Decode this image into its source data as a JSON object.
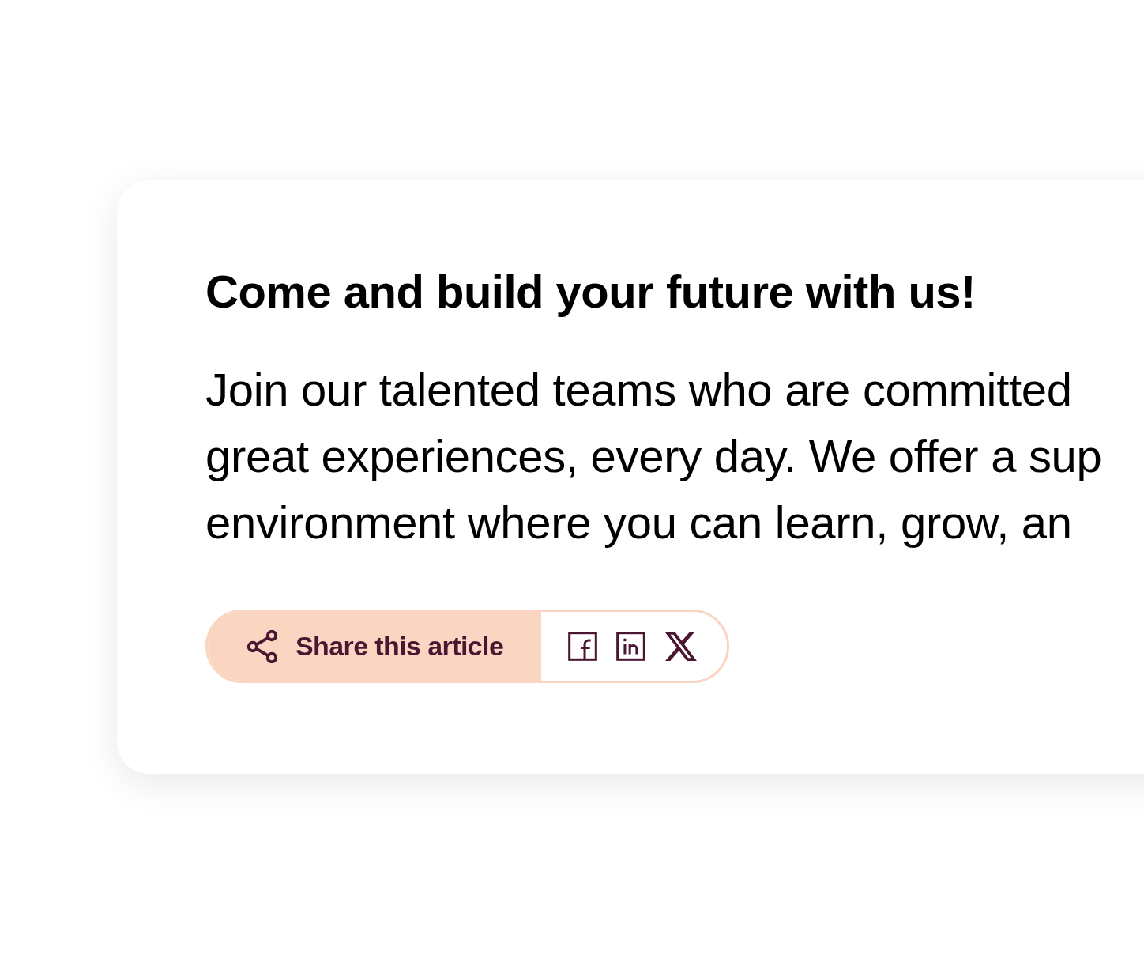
{
  "card": {
    "heading": "Come and build your future with us!",
    "paragraph_lines": [
      "Join our talented teams who are committed",
      "great experiences, every day. We offer a sup",
      "environment where you can learn, grow, an"
    ]
  },
  "share_bar": {
    "label": "Share this article"
  }
}
